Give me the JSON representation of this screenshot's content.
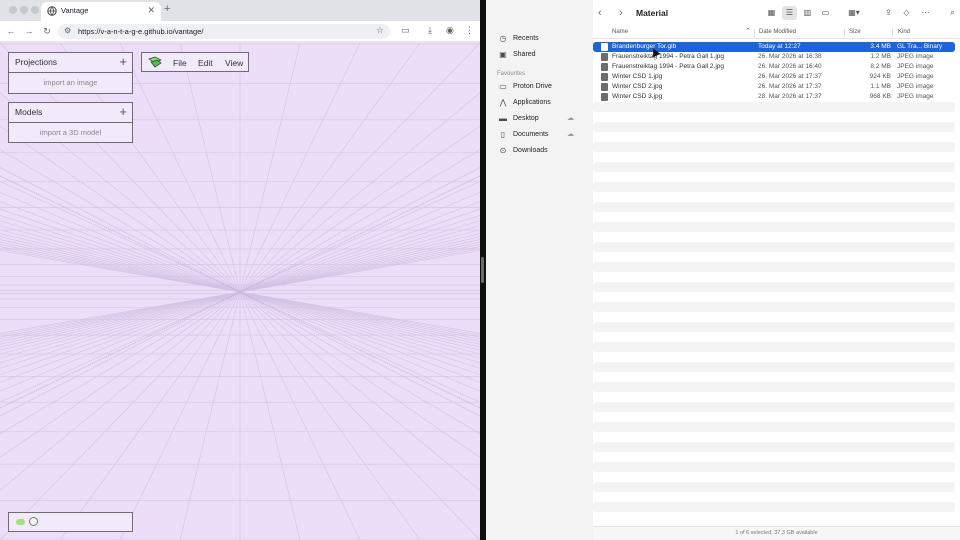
{
  "browser": {
    "tab_title": "Vantage",
    "url": "https://v-a-n-t-a-g-e.github.io/vantage/",
    "projections": {
      "title": "Projections",
      "action": "import an image"
    },
    "models": {
      "title": "Models",
      "action": "import a 3D model"
    },
    "menu": [
      "File",
      "Edit",
      "View"
    ]
  },
  "finder": {
    "folder": "Material",
    "sidebar": {
      "items_top": [
        "Recents",
        "Shared"
      ],
      "favourites_label": "Favourites",
      "favourites": [
        "Proton Drive",
        "Applications",
        "Desktop",
        "Documents",
        "Downloads"
      ]
    },
    "columns": {
      "name": "Name",
      "date": "Date Modified",
      "size": "Size",
      "kind": "Kind"
    },
    "files": [
      {
        "name": "Brandenburger Tor.glb",
        "date": "Today at 12:27",
        "size": "3.4 MB",
        "kind": "GL Tra... Binary"
      },
      {
        "name": "Frauenstreiktag 1994 - Petra Gall 1.jpg",
        "date": "26. Mar 2026 at 16:38",
        "size": "1.2 MB",
        "kind": "JPEG image"
      },
      {
        "name": "Frauenstreiktag 1994 - Petra Gall 2.jpg",
        "date": "26. Mar 2026 at 16:40",
        "size": "8.2 MB",
        "kind": "JPEG image"
      },
      {
        "name": "Winter CSD 1.jpg",
        "date": "26. Mar 2026 at 17:37",
        "size": "924 KB",
        "kind": "JPEG image"
      },
      {
        "name": "Winter CSD 2.jpg",
        "date": "26. Mar 2026 at 17:37",
        "size": "1.1 MB",
        "kind": "JPEG image"
      },
      {
        "name": "Winter CSD 3.jpg",
        "date": "28. Mar 2026 at 17:37",
        "size": "968 KB",
        "kind": "JPEG image"
      }
    ],
    "status": "1 of 6 selected, 37.3 GB available"
  }
}
